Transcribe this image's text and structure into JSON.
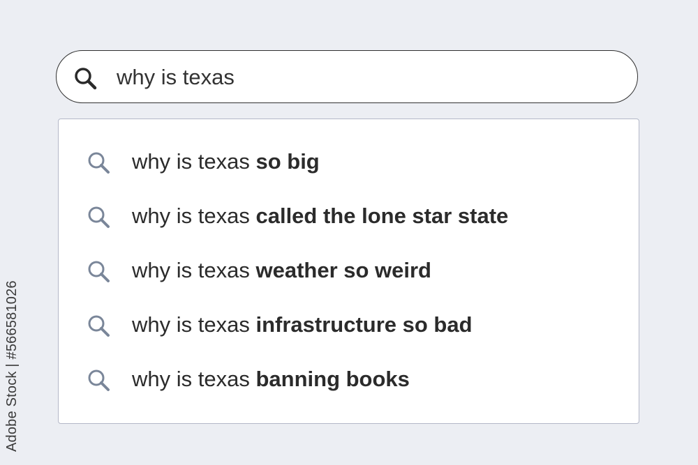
{
  "search": {
    "query": "why is texas",
    "icon": "search-icon"
  },
  "suggestions": [
    {
      "prefix": "why is texas",
      "completion": "so big",
      "icon": "search-icon"
    },
    {
      "prefix": "why is texas",
      "completion": "called the lone star state",
      "icon": "search-icon"
    },
    {
      "prefix": "why is texas",
      "completion": "weather so weird",
      "icon": "search-icon"
    },
    {
      "prefix": "why is texas",
      "completion": "infrastructure so bad",
      "icon": "search-icon"
    },
    {
      "prefix": "why is texas",
      "completion": "banning books",
      "icon": "search-icon"
    }
  ],
  "watermark": {
    "text": "Adobe Stock | #566581026"
  },
  "colors": {
    "background": "#eceef3",
    "suggestion_icon": "#7a8699",
    "bar_icon": "#2a2a2a",
    "text": "#2b2b2b"
  }
}
